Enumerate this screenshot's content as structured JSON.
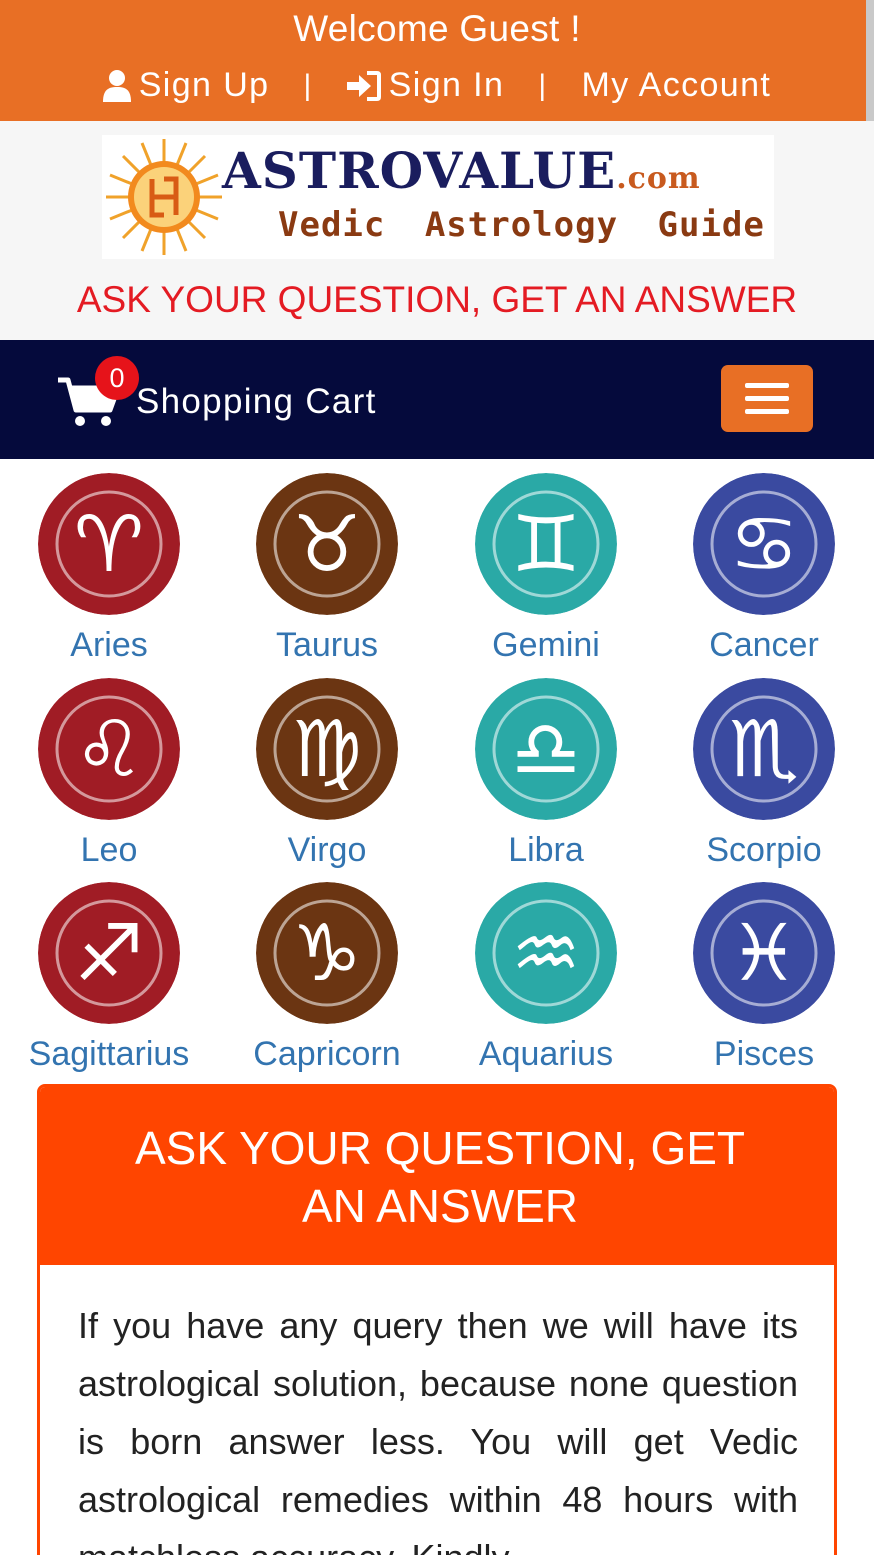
{
  "topbar": {
    "welcome": "Welcome Guest !",
    "links": [
      {
        "label": "Sign Up",
        "icon": "user-icon"
      },
      {
        "label": "Sign In",
        "icon": "sign-in-icon"
      },
      {
        "label": "My Account"
      }
    ],
    "separator": "|"
  },
  "logo": {
    "brand": "ASTROVALUE",
    "brand_suffix": ".com",
    "tagline": "Vedic Astrology Guide"
  },
  "ask_banner": "ASK YOUR QUESTION, GET AN ANSWER",
  "navbar": {
    "cart_label": "Shopping Cart",
    "cart_count": "0",
    "menu_icon": "hamburger-icon"
  },
  "zodiac": [
    {
      "name": "Aries",
      "color": "#a01c25"
    },
    {
      "name": "Taurus",
      "color": "#6b3512"
    },
    {
      "name": "Gemini",
      "color": "#2aa9a6"
    },
    {
      "name": "Cancer",
      "color": "#3a4aa0"
    },
    {
      "name": "Leo",
      "color": "#a01c25"
    },
    {
      "name": "Virgo",
      "color": "#6b3512"
    },
    {
      "name": "Libra",
      "color": "#2aa9a6"
    },
    {
      "name": "Scorpio",
      "color": "#3a4aa0"
    },
    {
      "name": "Sagittarius",
      "color": "#a01c25"
    },
    {
      "name": "Capricorn",
      "color": "#6b3512"
    },
    {
      "name": "Aquarius",
      "color": "#2aa9a6"
    },
    {
      "name": "Pisces",
      "color": "#3a4aa0"
    }
  ],
  "panel": {
    "heading": "ASK YOUR QUESTION, GET AN ANSWER",
    "body": "If you have any query then we will have its astrological solution, because none question is born answer less. You will get Vedic astrological remedies within 48 hours with matchless accuracy. Kindly"
  },
  "colors": {
    "topbar": "#e86f25",
    "navbar": "#050a3c",
    "accent_red": "#e41b23",
    "panel": "#ff4500",
    "link_blue": "#3374b0"
  }
}
